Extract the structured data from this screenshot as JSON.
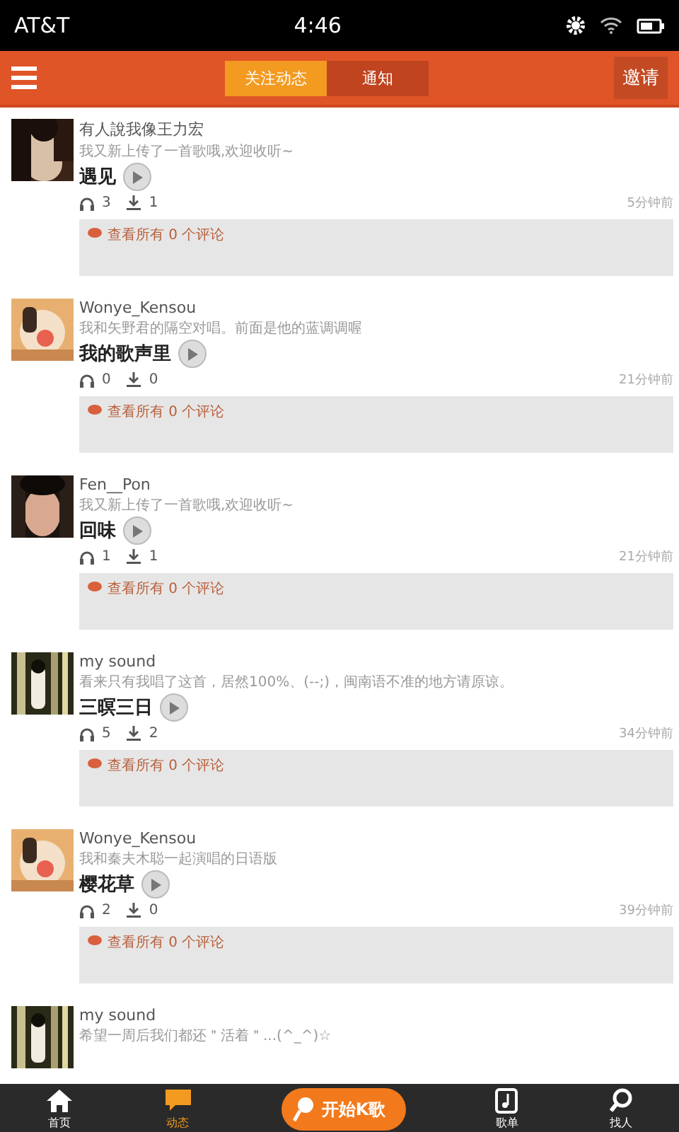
{
  "status_bar": {
    "carrier": "AT&T",
    "time": "4:46"
  },
  "header": {
    "tabs": [
      {
        "label": "关注动态",
        "selected": true
      },
      {
        "label": "通知",
        "selected": false
      }
    ],
    "invite": "邀请"
  },
  "posts": [
    {
      "user": "有人說我像王力宏",
      "message": "我又新上传了一首歌哦,欢迎收听~",
      "song": "遇见",
      "plays": "3",
      "downloads": "1",
      "time": "5分钟前",
      "comments": "查看所有 0 个评论"
    },
    {
      "user": "Wonye_Kensou",
      "message": "我和矢野君的隔空对唱。前面是他的蓝调调喔",
      "song": "我的歌声里",
      "plays": "0",
      "downloads": "0",
      "time": "21分钟前",
      "comments": "查看所有 0 个评论"
    },
    {
      "user": "Fen__Pon",
      "message": "我又新上传了一首歌哦,欢迎收听~",
      "song": "回味",
      "plays": "1",
      "downloads": "1",
      "time": "21分钟前",
      "comments": "查看所有 0 个评论"
    },
    {
      "user": "my sound",
      "message": "看来只有我唱了这首，居然100%、(--;)，闽南语不准的地方请原谅。",
      "song": "三暝三日",
      "plays": "5",
      "downloads": "2",
      "time": "34分钟前",
      "comments": "查看所有 0 个评论"
    },
    {
      "user": "Wonye_Kensou",
      "message": "我和秦夫木聪一起演唱的日语版",
      "song": "樱花草",
      "plays": "2",
      "downloads": "0",
      "time": "39分钟前",
      "comments": "查看所有 0 个评论"
    },
    {
      "user": "my sound",
      "message": "希望一周后我们都还＂活着＂...(^_^)☆"
    }
  ],
  "bottom_nav": [
    {
      "kind": "home",
      "label": "首页",
      "selected": false
    },
    {
      "kind": "feed",
      "label": "动态",
      "selected": true
    },
    {
      "kind": "record",
      "label": "开始K歌",
      "selected": false
    },
    {
      "kind": "songs",
      "label": "歌单",
      "selected": false
    },
    {
      "kind": "search",
      "label": "找人",
      "selected": false
    }
  ]
}
